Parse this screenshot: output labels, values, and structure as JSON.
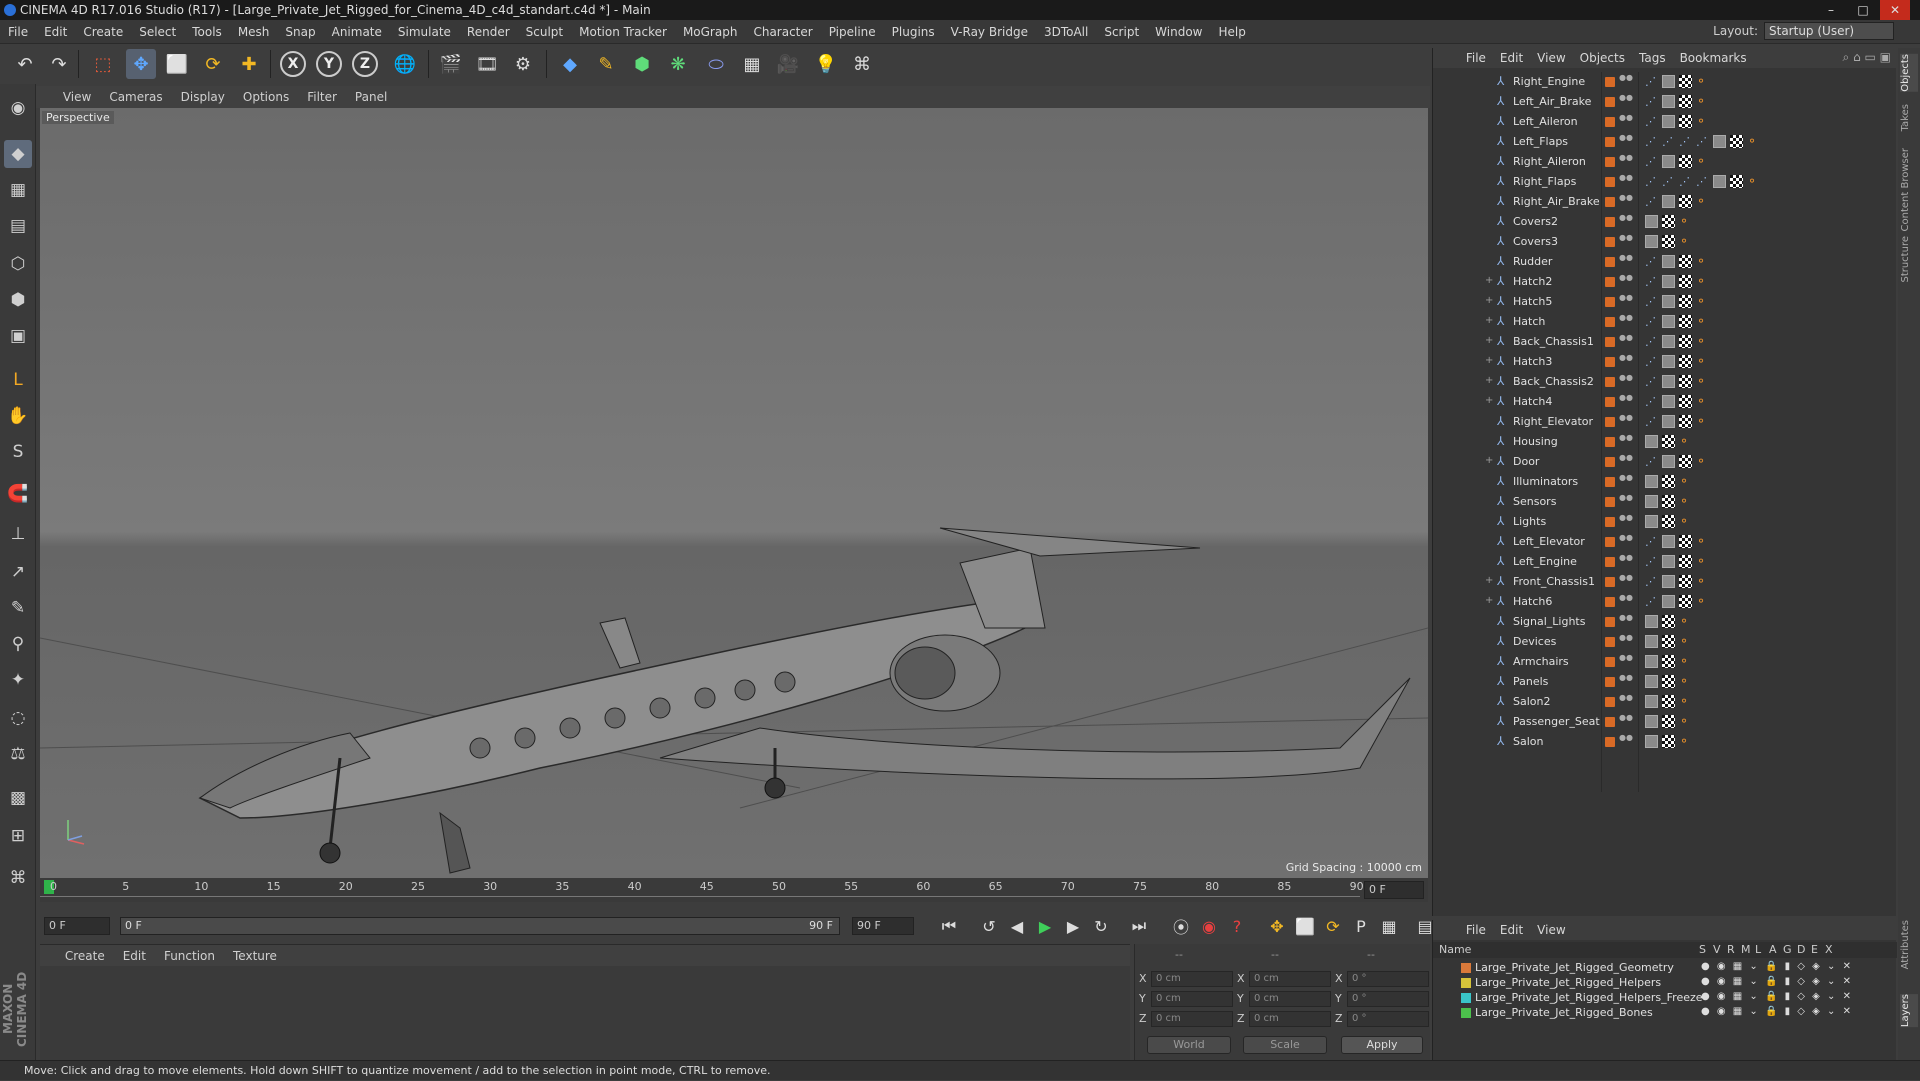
{
  "window": {
    "title": "CINEMA 4D R17.016 Studio (R17) - [Large_Private_Jet_Rigged_for_Cinema_4D_c4d_standart.c4d *] - Main",
    "controls": [
      "–",
      "□",
      "✕"
    ]
  },
  "menubar": {
    "items": [
      "File",
      "Edit",
      "Create",
      "Select",
      "Tools",
      "Mesh",
      "Snap",
      "Animate",
      "Simulate",
      "Render",
      "Sculpt",
      "Motion Tracker",
      "MoGraph",
      "Character",
      "Pipeline",
      "Plugins",
      "V-Ray Bridge",
      "3DToAll",
      "Script",
      "Window",
      "Help"
    ],
    "layout_label": "Layout:",
    "layout_value": "Startup (User)"
  },
  "toolbar": {
    "icons": [
      "undo-icon",
      "redo-icon",
      "live-selection-icon",
      "move-icon",
      "scale-icon",
      "rotate-icon",
      "add-icon",
      "x-axis-icon",
      "y-axis-icon",
      "z-axis-icon",
      "world-coord-icon",
      "render-view-icon",
      "render-picture-viewer-icon",
      "render-settings-icon",
      "cube-icon",
      "pen-icon",
      "subdivision-icon",
      "cloner-icon",
      "deformer-icon",
      "floor-icon",
      "camera-icon",
      "light-icon",
      "python-icon"
    ],
    "axis_labels": [
      "X",
      "Y",
      "Z"
    ]
  },
  "lefttools": {
    "icons": [
      "make-editable-icon",
      "model-mode-icon",
      "texture-mode-icon",
      "workplane-icon",
      "points-mode-icon",
      "edges-mode-icon",
      "polygons-mode-icon",
      "axis-mode-icon",
      "tweak-icon",
      "solo-icon",
      "magnet-icon",
      "joint-tool-icon",
      "ik-icon",
      "paint-weights-icon",
      "bind-icon",
      "skin-icon",
      "morph-icon",
      "weights-icon",
      "lock-workplane-icon",
      "quantize-icon",
      "python-script-icon"
    ],
    "brand": "MAXON CINEMA 4D"
  },
  "viewport": {
    "menu": [
      "View",
      "Cameras",
      "Display",
      "Options",
      "Filter",
      "Panel"
    ],
    "label": "Perspective",
    "grid_spacing": "Grid Spacing : 10000 cm"
  },
  "timeline": {
    "ticks": [
      "0",
      "5",
      "10",
      "15",
      "20",
      "25",
      "30",
      "35",
      "40",
      "45",
      "50",
      "55",
      "60",
      "65",
      "70",
      "75",
      "80",
      "85",
      "90"
    ],
    "current_frame": "0 F"
  },
  "playbar": {
    "start_frame": "0 F",
    "range_start": "0 F",
    "range_end": "90 F",
    "end_frame": "90 F"
  },
  "materials": {
    "menu": [
      "Create",
      "Edit",
      "Function",
      "Texture"
    ]
  },
  "coordinates": {
    "header": [
      "--",
      "--",
      "--"
    ],
    "rows": [
      {
        "pos_label": "X",
        "pos": "0 cm",
        "size_label": "X",
        "size": "0 cm",
        "rot_label": "X",
        "rot": "0 °"
      },
      {
        "pos_label": "Y",
        "pos": "0 cm",
        "size_label": "Y",
        "size": "0 cm",
        "rot_label": "Y",
        "rot": "0 °"
      },
      {
        "pos_label": "Z",
        "pos": "0 cm",
        "size_label": "Z",
        "size": "0 cm",
        "rot_label": "Z",
        "rot": "0 °"
      }
    ],
    "mode": "World",
    "scale": "Scale",
    "apply": "Apply"
  },
  "object_manager": {
    "menu": [
      "File",
      "Edit",
      "View",
      "Objects",
      "Tags",
      "Bookmarks"
    ],
    "objects": [
      {
        "name": "Right_Engine",
        "expandable": false,
        "tags": "long"
      },
      {
        "name": "Left_Air_Brake",
        "expandable": false,
        "tags": "long"
      },
      {
        "name": "Left_Aileron",
        "expandable": false,
        "tags": "long"
      },
      {
        "name": "Left_Flaps",
        "expandable": false,
        "tags": "xlong"
      },
      {
        "name": "Right_Aileron",
        "expandable": false,
        "tags": "long"
      },
      {
        "name": "Right_Flaps",
        "expandable": false,
        "tags": "xlong"
      },
      {
        "name": "Right_Air_Brake",
        "expandable": false,
        "tags": "long"
      },
      {
        "name": "Covers2",
        "expandable": false,
        "tags": "short"
      },
      {
        "name": "Covers3",
        "expandable": false,
        "tags": "short"
      },
      {
        "name": "Rudder",
        "expandable": false,
        "tags": "long"
      },
      {
        "name": "Hatch2",
        "expandable": true,
        "tags": "long"
      },
      {
        "name": "Hatch5",
        "expandable": true,
        "tags": "long"
      },
      {
        "name": "Hatch",
        "expandable": true,
        "tags": "long"
      },
      {
        "name": "Back_Chassis1",
        "expandable": true,
        "tags": "long"
      },
      {
        "name": "Hatch3",
        "expandable": true,
        "tags": "long"
      },
      {
        "name": "Back_Chassis2",
        "expandable": true,
        "tags": "long"
      },
      {
        "name": "Hatch4",
        "expandable": true,
        "tags": "long"
      },
      {
        "name": "Right_Elevator",
        "expandable": false,
        "tags": "long"
      },
      {
        "name": "Housing",
        "expandable": false,
        "tags": "short"
      },
      {
        "name": "Door",
        "expandable": true,
        "tags": "long"
      },
      {
        "name": "Illuminators",
        "expandable": false,
        "tags": "short"
      },
      {
        "name": "Sensors",
        "expandable": false,
        "tags": "short"
      },
      {
        "name": "Lights",
        "expandable": false,
        "tags": "short"
      },
      {
        "name": "Left_Elevator",
        "expandable": false,
        "tags": "long"
      },
      {
        "name": "Left_Engine",
        "expandable": false,
        "tags": "long"
      },
      {
        "name": "Front_Chassis1",
        "expandable": true,
        "tags": "long"
      },
      {
        "name": "Hatch6",
        "expandable": true,
        "tags": "long"
      },
      {
        "name": "Signal_Lights",
        "expandable": false,
        "tags": "short"
      },
      {
        "name": "Devices",
        "expandable": false,
        "tags": "short"
      },
      {
        "name": "Armchairs",
        "expandable": false,
        "tags": "short"
      },
      {
        "name": "Panels",
        "expandable": false,
        "tags": "short"
      },
      {
        "name": "Salon2",
        "expandable": false,
        "tags": "short"
      },
      {
        "name": "Passenger_Seat",
        "expandable": false,
        "tags": "short"
      },
      {
        "name": "Salon",
        "expandable": false,
        "tags": "short"
      }
    ]
  },
  "right_tabs": [
    "Objects",
    "Takes",
    "Content Browser",
    "Structure",
    "Attributes",
    "Layers"
  ],
  "layer_manager": {
    "menu": [
      "File",
      "Edit",
      "View"
    ],
    "columns": {
      "name": "Name",
      "flags": [
        "S",
        "V",
        "R",
        "M",
        "L",
        "A",
        "G",
        "D",
        "E",
        "X"
      ]
    },
    "layers": [
      {
        "name": "Large_Private_Jet_Rigged_Geometry",
        "color": "#d9793a"
      },
      {
        "name": "Large_Private_Jet_Rigged_Helpers",
        "color": "#d6c33a"
      },
      {
        "name": "Large_Private_Jet_Rigged_Helpers_Freeze",
        "color": "#3ac6c9"
      },
      {
        "name": "Large_Private_Jet_Rigged_Bones",
        "color": "#4cc14c"
      }
    ]
  },
  "statusbar": {
    "text": "Move: Click and drag to move elements. Hold down SHIFT to quantize movement / add to the selection in point mode, CTRL to remove."
  }
}
